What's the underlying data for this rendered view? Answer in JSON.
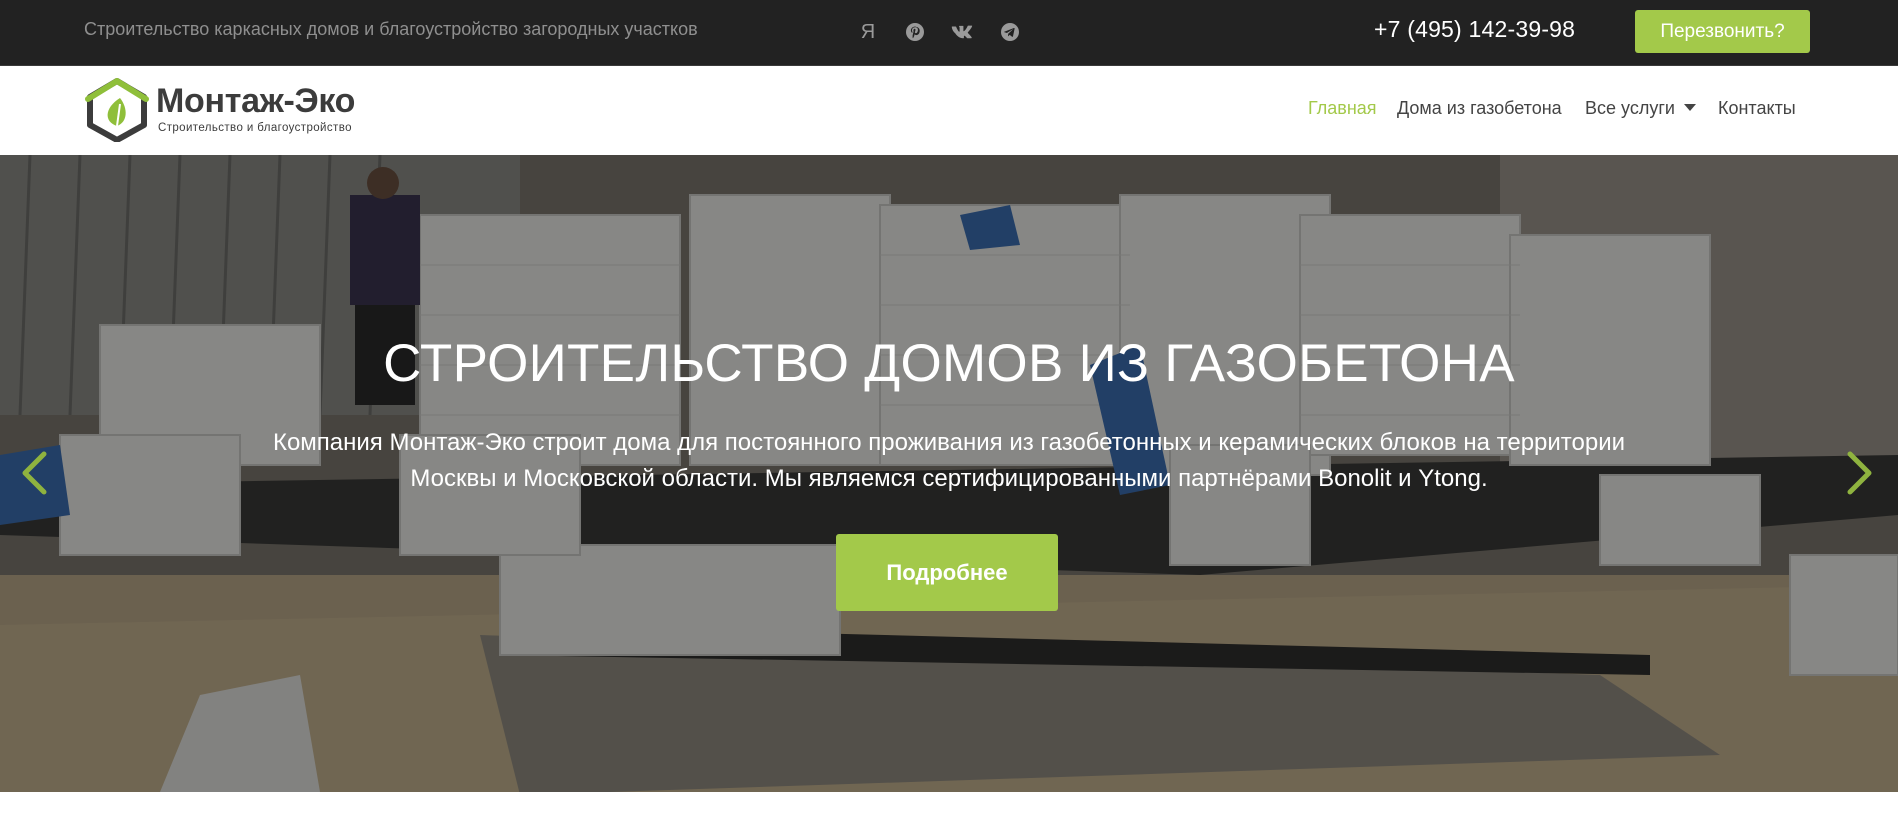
{
  "topbar": {
    "tagline": "Строительство каркасных домов и благоустройство загородных участков",
    "social": [
      {
        "name": "yandex-icon",
        "glyph": "Я"
      },
      {
        "name": "pinterest-icon"
      },
      {
        "name": "vk-icon"
      },
      {
        "name": "telegram-icon"
      }
    ],
    "phone": "+7 (495) 142-39-98",
    "callback_label": "Перезвонить?"
  },
  "header": {
    "logo": {
      "name": "Монтаж-Эко",
      "slogan": "Строительство и благоустройство"
    },
    "nav": [
      {
        "label": "Главная",
        "active": true
      },
      {
        "label": "Дома из газобетона",
        "active": false
      },
      {
        "label": "Все услуги",
        "active": false,
        "has_dropdown": true
      },
      {
        "label": "Контакты",
        "active": false
      }
    ]
  },
  "hero": {
    "title": "СТРОИТЕЛЬСТВО ДОМОВ ИЗ ГАЗОБЕТОНА",
    "text": "Компания Монтаж-Эко строит дома для постоянного проживания из газобетонных и керамических блоков на территории Москвы и Московской области. Мы являемся сертифицированными партнёрами Bonolit и Ytong.",
    "button_label": "Подробнее",
    "prev_icon": "chevron-left-icon",
    "next_icon": "chevron-right-icon"
  },
  "colors": {
    "accent": "#a3c94a",
    "topbar_bg": "#222222",
    "nav_text": "#444444",
    "tagline_text": "#8f8f8f"
  }
}
